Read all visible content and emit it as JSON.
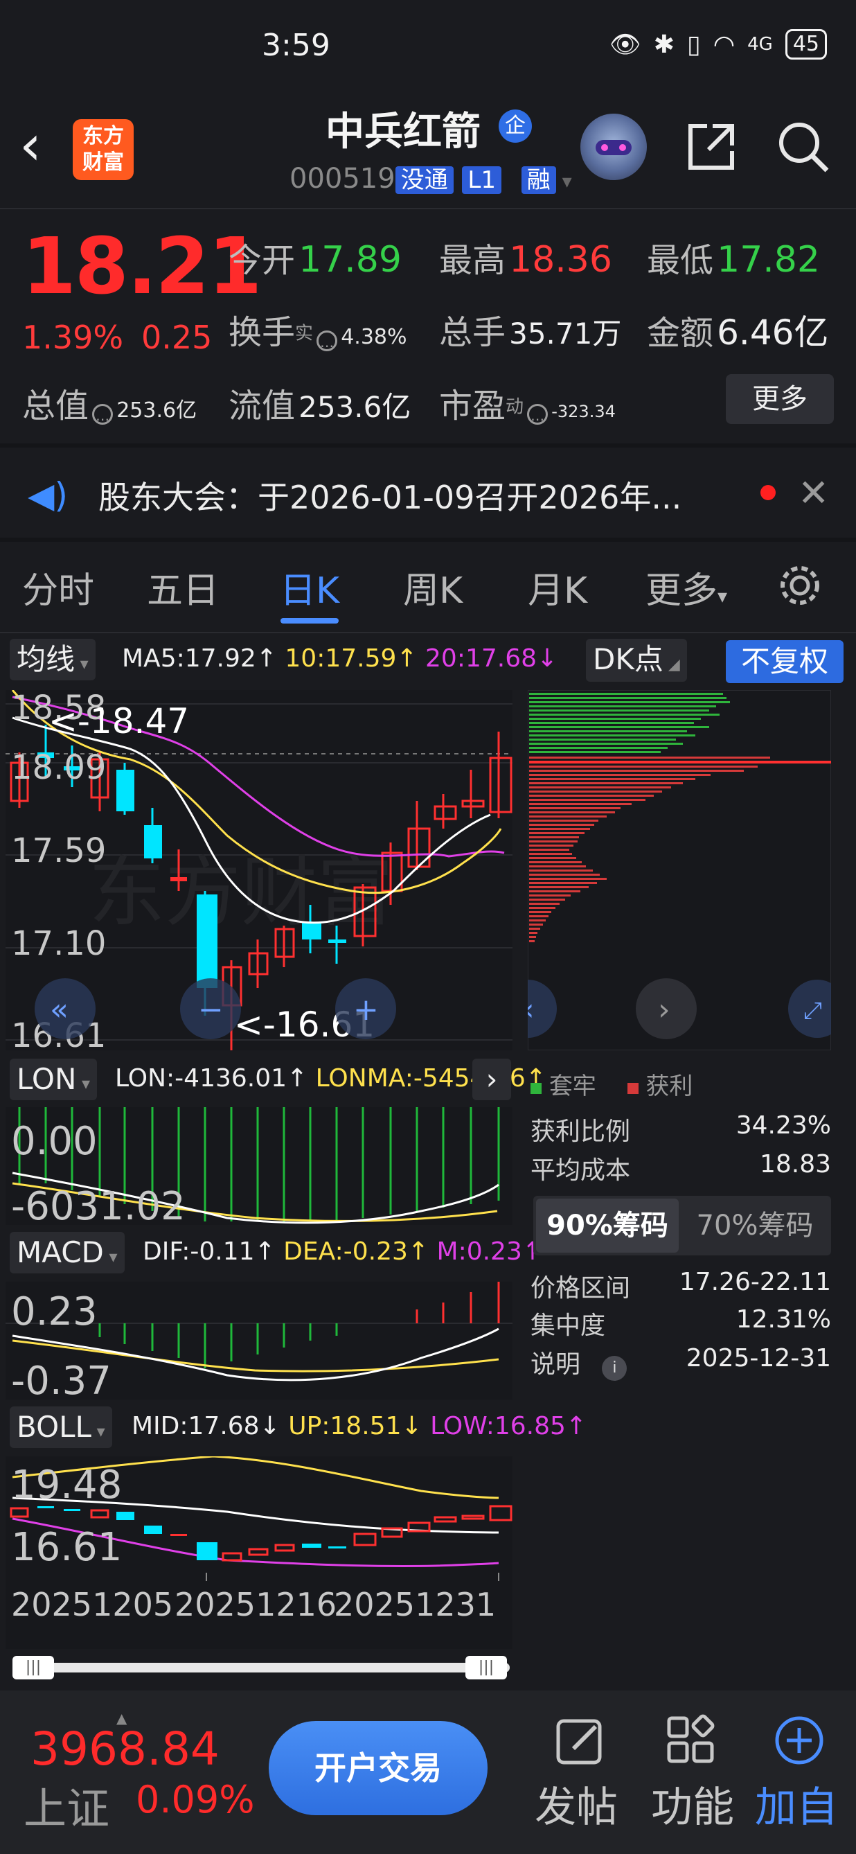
{
  "status_bar": {
    "time": "3:59",
    "network": "4G",
    "battery": "45"
  },
  "header": {
    "logo_line1": "东方",
    "logo_line2": "财富",
    "stock_name": "中兵红箭",
    "badge": "企",
    "stock_code": "000519",
    "tag1": "没通",
    "tag2": "L1",
    "tag3": "融"
  },
  "quote": {
    "price": "18.21",
    "change_pct": "1.39%",
    "change": "0.25",
    "open_label": "今开",
    "open": "17.89",
    "high_label": "最高",
    "high": "18.36",
    "low_label": "最低",
    "low": "17.82",
    "turnover_label": "换手",
    "turnover_sup": "实",
    "turnover": "4.38%",
    "volume_label": "总手",
    "volume": "35.71万",
    "amount_label": "金额",
    "amount": "6.46亿",
    "mcap_label": "总值",
    "mcap": "253.6亿",
    "float_label": "流值",
    "float": "253.6亿",
    "pe_label": "市盈",
    "pe_sup": "动",
    "pe": "-323.34",
    "more": "更多"
  },
  "notice": {
    "text": "股东大会：于2026-01-09召开2026年..."
  },
  "tabs": [
    {
      "label": "分时"
    },
    {
      "label": "五日"
    },
    {
      "label": "日K",
      "active": true
    },
    {
      "label": "周K"
    },
    {
      "label": "月K"
    },
    {
      "label": "更多"
    }
  ],
  "kline": {
    "ma_selector": "均线",
    "ma5": "MA5:17.92↑",
    "ma10": "10:17.59↑",
    "ma20": "20:17.68↓",
    "dk": "DK点",
    "adjust": "不复权",
    "y_labels": [
      "18.58",
      "18.09",
      "17.59",
      "17.10",
      "16.61"
    ],
    "high_marker": "<-18.47",
    "low_marker": "<-16.61",
    "watermark": "东方财富"
  },
  "lon": {
    "selector": "LON",
    "lon": "LON:-4136.01↑",
    "lonma": "LONMA:-5454.06↑",
    "y_top": "0.00",
    "y_bottom": "-6031.02"
  },
  "macd": {
    "selector": "MACD",
    "dif": "DIF:-0.11↑",
    "dea": "DEA:-0.23↑",
    "m": "M:0.23↑",
    "y_top": "0.23",
    "y_bottom": "-0.37"
  },
  "boll": {
    "selector": "BOLL",
    "mid": "MID:17.68↓",
    "up": "UP:18.51↓",
    "low": "LOW:16.85↑",
    "y_top": "19.48",
    "y_bottom": "16.61",
    "dates": [
      "20251205",
      "20251216",
      "20251231"
    ]
  },
  "chips": {
    "legend_trapped": "套牢",
    "legend_profit": "获利",
    "rows": [
      {
        "label": "获利比例",
        "value": "34.23%"
      },
      {
        "label": "平均成本",
        "value": "18.83"
      }
    ],
    "tab_90": "90%筹码",
    "tab_70": "70%筹码",
    "rows2": [
      {
        "label": "价格区间",
        "value": "17.26-22.11"
      },
      {
        "label": "集中度",
        "value": "12.31%"
      },
      {
        "label": "说明",
        "value": "2025-12-31"
      }
    ]
  },
  "bottom_bar": {
    "index_value": "3968.84",
    "index_name": "上证",
    "index_pct": "0.09%",
    "trade": "开户交易",
    "post": "发帖",
    "func": "功能",
    "add": "加自"
  },
  "colors": {
    "up": "#ff2b2b",
    "down": "#35d14a",
    "accent": "#2d6be0"
  }
}
